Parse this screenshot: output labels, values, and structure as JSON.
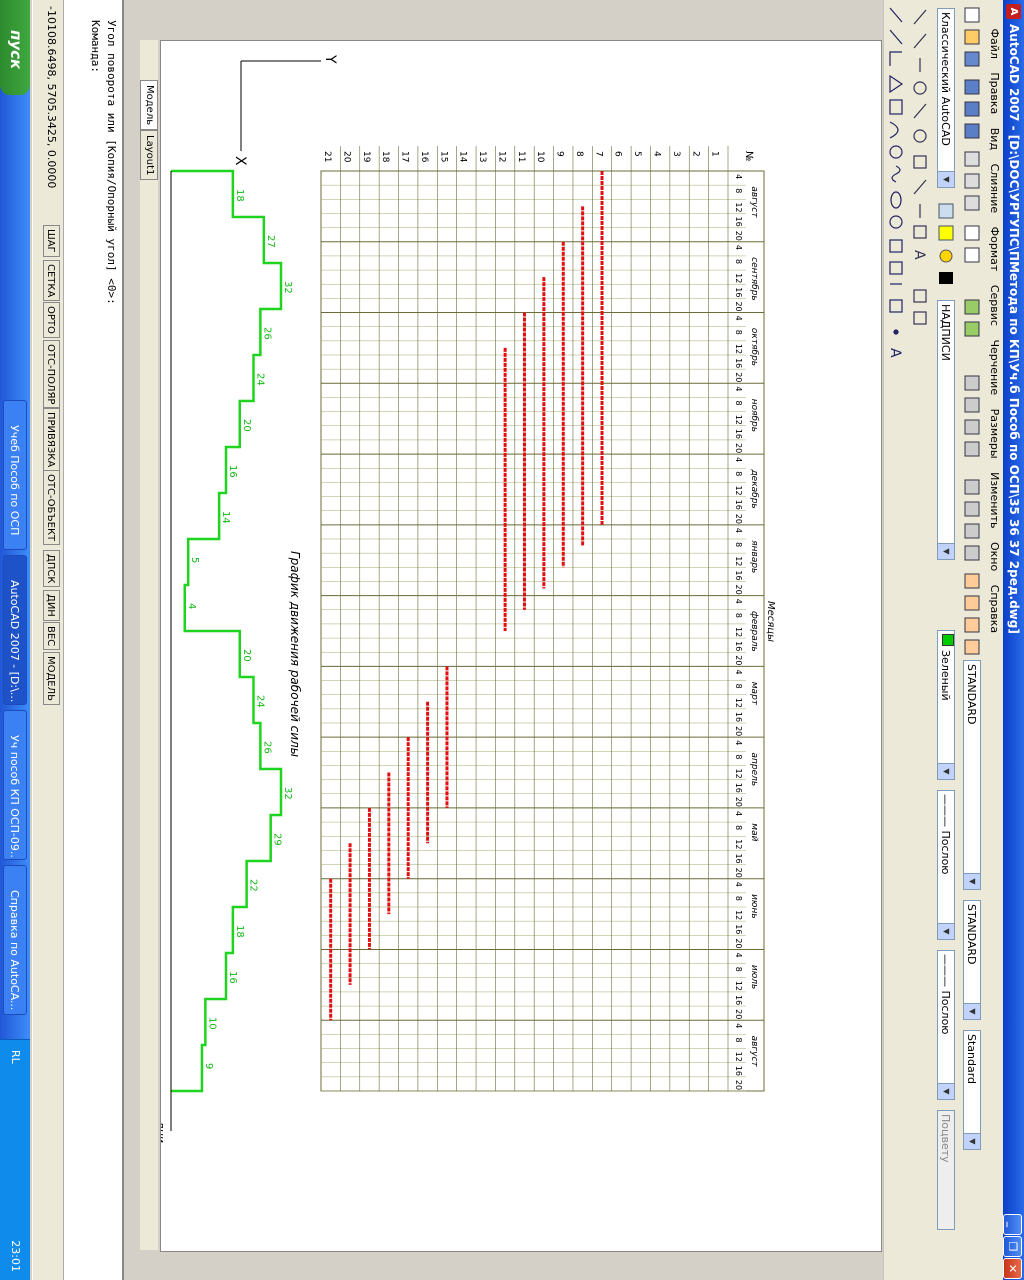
{
  "window": {
    "title": "AutoCAD 2007 - [D:\\DOC\\УРГУПС\\ПМетода по КП\\Уч.б Пособ по ОСП\\35 36 37 2ред.dwg]",
    "app_icon": "A"
  },
  "menu": [
    "Файл",
    "Правка",
    "Вид",
    "Слияние",
    "Формат",
    "Сервис",
    "Черчение",
    "Размеры",
    "Изменить",
    "Окно",
    "Справка"
  ],
  "toolbar": {
    "workspace": "Классический AutoCAD",
    "layer": "НАДПИСИ",
    "text_style": "STANDARD",
    "dim_style": "STANDARD",
    "table_style": "Standard",
    "table_style2": "STANDARD",
    "color": "Зеленый",
    "linetype": "Послою",
    "lineweight": "Послою",
    "plotstyle": "Поцвету"
  },
  "drawing": {
    "chart_title": "График движения рабочей силы",
    "axis_days": "дни",
    "months_label": "Месяцы",
    "no_label": "№",
    "months": [
      "август",
      "сентябрь",
      "октябрь",
      "ноябрь",
      "декабрь",
      "январь",
      "февраль",
      "март",
      "апрель",
      "май",
      "июнь",
      "июль",
      "август"
    ],
    "subticks": [
      "4",
      "8",
      "12",
      "16",
      "20"
    ],
    "row_numbers": [
      "1",
      "2",
      "3",
      "4",
      "5",
      "6",
      "7",
      "8",
      "9",
      "10",
      "11",
      "12",
      "13",
      "14",
      "15",
      "16",
      "17",
      "18",
      "19",
      "20",
      "21"
    ],
    "workforce_labels": [
      "18",
      "27",
      "32",
      "26",
      "24",
      "20",
      "16",
      "14",
      "5",
      "4",
      "20",
      "24",
      "26",
      "32",
      "29",
      "22",
      "18",
      "16",
      "10",
      "9"
    ],
    "ucs_x": "X",
    "ucs_y": "Y"
  },
  "layout_tabs": [
    "Модель",
    "Layout1"
  ],
  "command": {
    "line1": "Угол поворота или [Копия/Опорный угол] <0>:",
    "line2": "Команда:"
  },
  "status": {
    "coords": "-10108.6498, 5705.3425, 0.0000",
    "buttons": [
      "ШАГ",
      "СЕТКА",
      "ОРТО",
      "ОТС-ПОЛЯР",
      "ПРИВЯЗКА",
      "ОТС-ОБЪЕКТ",
      "ДПСК",
      "ДИН",
      "ВЕС",
      "МОДЕЛЬ"
    ]
  },
  "taskbar": {
    "start": "пуск",
    "tasks": [
      "Учеб Пособ по ОСП",
      "AutoCAD 2007 - [D:\\...",
      "Уч пособ КП ОСП-09...",
      "Справка по AutoCA..."
    ],
    "lang": "RL",
    "clock": "23:01"
  }
}
